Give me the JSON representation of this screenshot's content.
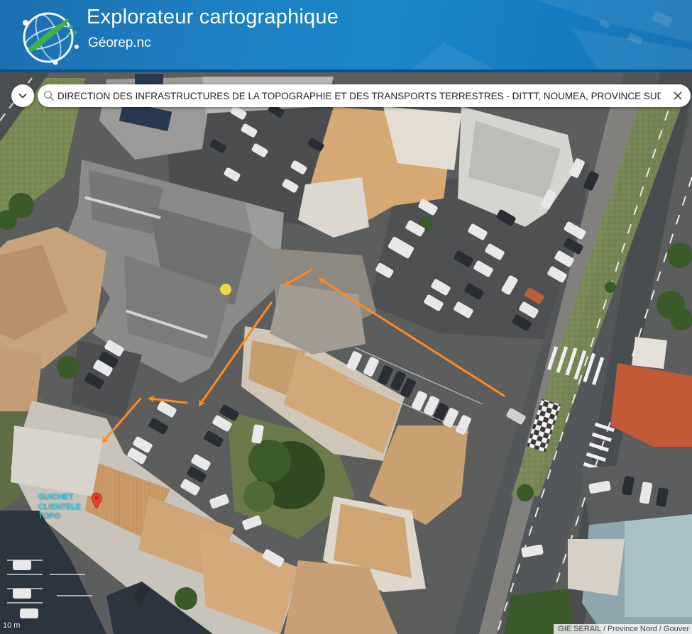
{
  "header": {
    "title": "Explorateur cartographique",
    "subtitle": "Géorep.nc"
  },
  "search": {
    "value": "DIRECTION DES INFRASTRUCTURES DE LA TOPOGRAPHIE ET DES TRANSPORTS TERRESTRES - DITTT, NOUMEA, PROVINCE SUD",
    "icon": "search-icon",
    "clear_icon": "close-icon",
    "toggle_icon": "chevron-down-icon"
  },
  "map": {
    "annotation_line1": "GUICHET",
    "annotation_line2": "CLIENTELE",
    "annotation_line3": "TOPO",
    "attribution": "GIE SERAIL / Province Nord / Gouver",
    "scale_label": "10 m",
    "arrow_color": "#ff8a1e",
    "marker_color": "#e8413a",
    "highlight_color": "#f4e43c",
    "annotation_color": "#22e0ff"
  },
  "colors": {
    "header_blue": "#1a7fc4"
  }
}
